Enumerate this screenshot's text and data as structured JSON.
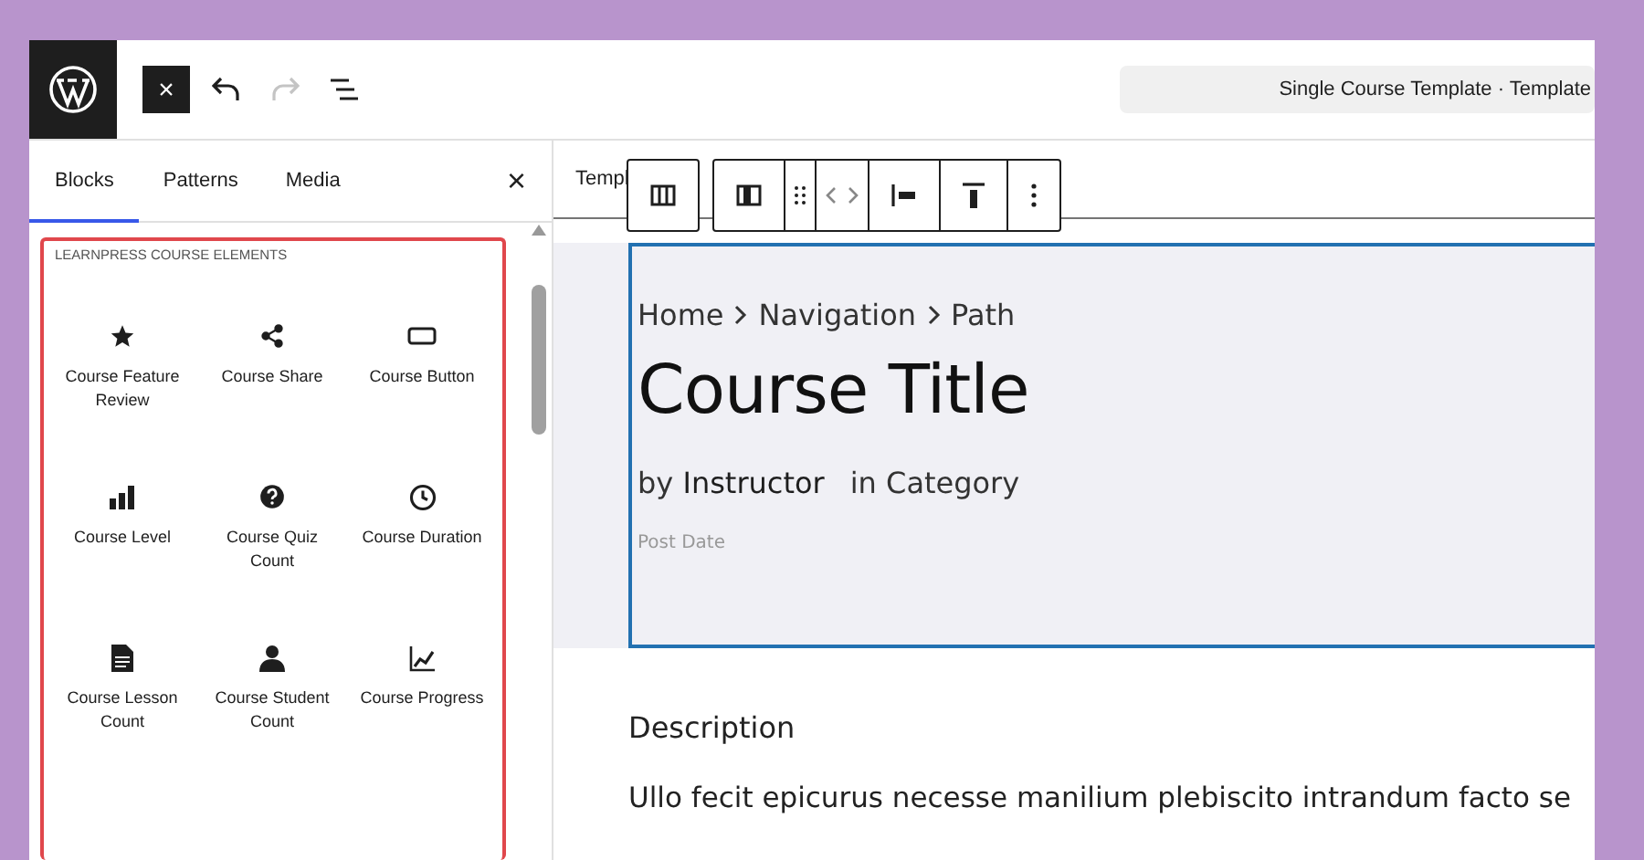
{
  "top_bar": {
    "close_button": "×",
    "tools": [
      {
        "kind": "undo",
        "disabled": false
      },
      {
        "kind": "redo",
        "disabled": true
      },
      {
        "kind": "list-view",
        "disabled": false
      }
    ],
    "document_title": "Single Course Template · Template"
  },
  "sidebar": {
    "tabs": [
      {
        "label": "Blocks",
        "selected": true
      },
      {
        "label": "Patterns",
        "selected": false
      },
      {
        "label": "Media",
        "selected": false
      }
    ],
    "close": "×",
    "group": {
      "title": "LEARNPRESS COURSE ELEMENTS",
      "items": [
        {
          "label": "Course Feature Review",
          "kind": "star"
        },
        {
          "label": "Course Share",
          "kind": "share"
        },
        {
          "label": "Course Button",
          "kind": "button"
        },
        {
          "label": "Course Level",
          "kind": "level"
        },
        {
          "label": "Course Quiz Count",
          "kind": "quiz"
        },
        {
          "label": "Course Duration",
          "kind": "clock"
        },
        {
          "label": "Course Lesson Count",
          "kind": "lesson"
        },
        {
          "label": "Course Student Count",
          "kind": "student"
        },
        {
          "label": "Course Progress",
          "kind": "progress"
        }
      ]
    }
  },
  "canvas": {
    "tab": "Templ",
    "breadcrumb": [
      "Home",
      "Navigation",
      "Path"
    ],
    "title": "Course Title",
    "byline": {
      "by": "by",
      "author": "Instructor",
      "category": "in Category"
    },
    "post_date": "Post Date",
    "description_heading": "Description",
    "description_text": "Ullo fecit epicurus necesse manilium plebiscito intrandum facto se"
  }
}
